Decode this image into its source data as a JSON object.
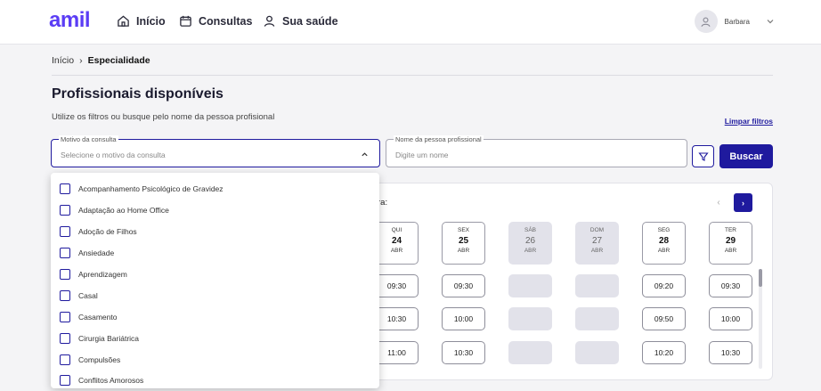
{
  "brand": {
    "logo": "amil",
    "accent": "#1f1a9e",
    "logo_color": "#5b3df5"
  },
  "nav": [
    {
      "label": "Início",
      "icon": "home-icon"
    },
    {
      "label": "Consultas",
      "icon": "calendar-icon"
    },
    {
      "label": "Sua saúde",
      "icon": "person-icon"
    }
  ],
  "user": {
    "name": "Barbara"
  },
  "breadcrumb": {
    "home": "Início",
    "separator": "›",
    "current": "Especialidade"
  },
  "page": {
    "title": "Profissionais disponíveis",
    "subtitle": "Utilize os filtros ou busque pelo nome da pessoa profisional",
    "clear_filters": "Limpar filtros"
  },
  "filters": {
    "motivo": {
      "label": "Motivo da consulta",
      "placeholder": "Selecione o motivo da consulta"
    },
    "nome": {
      "label": "Nome da pessoa profissional",
      "placeholder": "Digite um nome"
    },
    "search_label": "Buscar"
  },
  "dropdown_options": [
    "Acompanhamento Psicológico de Gravidez",
    "Adaptação ao Home Office",
    "Adoção de Filhos",
    "Ansiedade",
    "Aprendizagem",
    "Casal",
    "Casamento",
    "Cirurgia Bariátrica",
    "Compulsões",
    "Conflitos Amorosos"
  ],
  "schedule": {
    "partial_label": "ra:",
    "prev": "‹",
    "next": "›",
    "days": [
      {
        "weekday": "QUI",
        "day": "24",
        "month": "ABR",
        "available": true,
        "slots": [
          "09:30",
          "10:30",
          "11:00"
        ]
      },
      {
        "weekday": "SEX",
        "day": "25",
        "month": "ABR",
        "available": true,
        "slots": [
          "09:30",
          "10:00",
          "10:30"
        ]
      },
      {
        "weekday": "SÁB",
        "day": "26",
        "month": "ABR",
        "available": false,
        "slots": [
          "",
          "",
          ""
        ]
      },
      {
        "weekday": "DOM",
        "day": "27",
        "month": "ABR",
        "available": false,
        "slots": [
          "",
          "",
          ""
        ]
      },
      {
        "weekday": "SEG",
        "day": "28",
        "month": "ABR",
        "available": true,
        "slots": [
          "09:20",
          "09:50",
          "10:20"
        ]
      },
      {
        "weekday": "TER",
        "day": "29",
        "month": "ABR",
        "available": true,
        "slots": [
          "09:30",
          "10:00",
          "10:30"
        ]
      }
    ]
  }
}
